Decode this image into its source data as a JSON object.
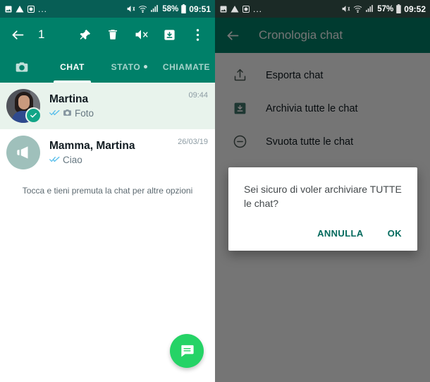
{
  "left": {
    "statusbar": {
      "icons": [
        "image-icon",
        "warning-icon",
        "screenshot-icon"
      ],
      "overflow": "...",
      "mute_icon": "mute-icon",
      "wifi_icon": "wifi-icon",
      "signal_icon": "signal-icon",
      "battery_text": "58%",
      "battery_icon": "battery-icon",
      "clock": "09:51"
    },
    "toolbar": {
      "back_icon": "back-arrow-icon",
      "selection_count": "1",
      "actions": [
        {
          "name": "pin-button",
          "icon": "pin-icon"
        },
        {
          "name": "delete-button",
          "icon": "trash-icon"
        },
        {
          "name": "mute-button",
          "icon": "mute-icon"
        },
        {
          "name": "archive-button",
          "icon": "archive-icon"
        },
        {
          "name": "more-options-button",
          "icon": "overflow-menu-icon"
        }
      ]
    },
    "tabs": [
      {
        "label": "",
        "name": "tab-camera",
        "icon": "camera-icon",
        "active": false
      },
      {
        "label": "CHAT",
        "name": "tab-chat",
        "active": true
      },
      {
        "label": "STATO",
        "name": "tab-stato",
        "active": false,
        "dot": true
      },
      {
        "label": "CHIAMATE",
        "name": "tab-chiamate",
        "active": false
      }
    ],
    "chats": [
      {
        "name": "Martina",
        "preview": "Foto",
        "time": "09:44",
        "selected": true,
        "avatar_type": "photo",
        "status_icon": "double-check-icon",
        "preview_icon": "camera-icon"
      },
      {
        "name": "Mamma, Martina",
        "preview": "Ciao",
        "time": "26/03/19",
        "selected": false,
        "avatar_type": "broadcast",
        "status_icon": "double-check-icon",
        "preview_icon": ""
      }
    ],
    "hint": "Tocca e tieni premuta la chat per altre opzioni",
    "fab": {
      "name": "new-chat-fab",
      "icon": "chat-bubble-icon",
      "color": "#25d366"
    }
  },
  "right": {
    "statusbar": {
      "overflow": "...",
      "battery_text": "57%",
      "clock": "09:52"
    },
    "toolbar": {
      "back_icon": "back-arrow-icon",
      "title": "Cronologia chat"
    },
    "menu_items": [
      {
        "label": "Esporta chat",
        "icon": "export-icon",
        "name": "menu-item-esporta-chat"
      },
      {
        "label": "Archivia tutte le chat",
        "icon": "archive-icon",
        "name": "menu-item-archivia-tutte-le-chat"
      },
      {
        "label": "Svuota tutte le chat",
        "icon": "minus-circle-icon",
        "name": "menu-item-svuota-tutte-le-chat"
      }
    ],
    "dialog": {
      "message": "Sei sicuro di voler archiviare TUTTE le chat?",
      "cancel_label": "ANNULLA",
      "confirm_label": "OK",
      "accent_color": "#00695c"
    }
  },
  "theme": {
    "primary": "#008069",
    "status_bar": "#075e55",
    "selected_row": "#e8f3ec",
    "fab": "#25d366",
    "check_blue": "#53bdeb"
  }
}
